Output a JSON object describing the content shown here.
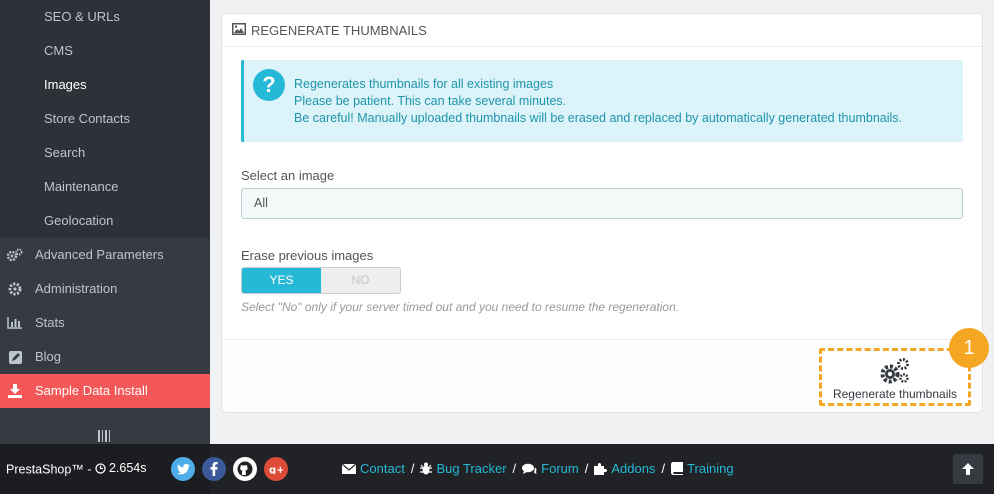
{
  "sidebar": {
    "sub_items": [
      {
        "label": "SEO & URLs",
        "active": false
      },
      {
        "label": "CMS",
        "active": false
      },
      {
        "label": "Images",
        "active": true
      },
      {
        "label": "Store Contacts",
        "active": false
      },
      {
        "label": "Search",
        "active": false
      },
      {
        "label": "Maintenance",
        "active": false
      },
      {
        "label": "Geolocation",
        "active": false
      }
    ],
    "main_items": [
      {
        "label": "Advanced Parameters",
        "icon": "gears-icon"
      },
      {
        "label": "Administration",
        "icon": "gear-icon"
      },
      {
        "label": "Stats",
        "icon": "bar-chart-icon"
      },
      {
        "label": "Blog",
        "icon": "pencil-square-icon"
      },
      {
        "label": "Sample Data Install",
        "icon": "download-icon"
      }
    ]
  },
  "panel": {
    "title": "REGENERATE THUMBNAILS",
    "alert_lines": [
      "Regenerates thumbnails for all existing images",
      "Please be patient. This can take several minutes.",
      "Be careful! Manually uploaded thumbnails will be erased and replaced by automatically generated thumbnails."
    ],
    "select_label": "Select an image",
    "select_value": "All",
    "erase_label": "Erase previous images",
    "yes_label": "YES",
    "no_label": "NO",
    "help_text": "Select \"No\" only if your server timed out and you need to resume the regeneration.",
    "regen_button": "Regenerate thumbnails",
    "callout_number": "1"
  },
  "footer": {
    "brand": "PrestaShop™ -",
    "timer": "2.654s",
    "links": [
      "Contact",
      "Bug Tracker",
      "Forum",
      "Addons",
      "Training"
    ],
    "separator": "/"
  },
  "colors": {
    "accent": "#25b9d7",
    "sidebar": "#363a41",
    "highlight_red": "#f45757",
    "callout_orange": "#f5a623"
  }
}
